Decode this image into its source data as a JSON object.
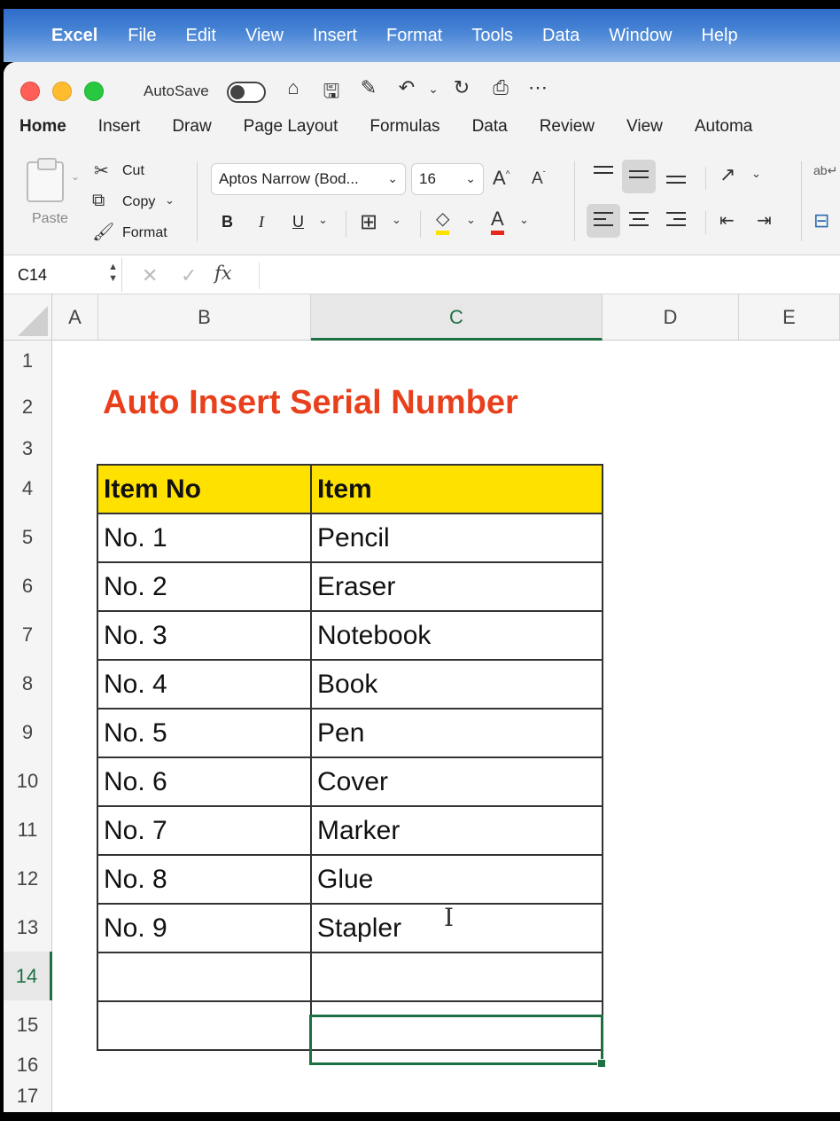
{
  "menubar": {
    "app": "Excel",
    "items": [
      "File",
      "Edit",
      "View",
      "Insert",
      "Format",
      "Tools",
      "Data",
      "Window",
      "Help"
    ]
  },
  "titlebar": {
    "autosave_label": "AutoSave"
  },
  "tabs": [
    "Home",
    "Insert",
    "Draw",
    "Page Layout",
    "Formulas",
    "Data",
    "Review",
    "View",
    "Automa"
  ],
  "ribbon": {
    "paste": "Paste",
    "cut": "Cut",
    "copy": "Copy",
    "format": "Format",
    "font_name": "Aptos Narrow (Bod...",
    "font_size": "16",
    "bold": "B",
    "italic": "I",
    "underline": "U"
  },
  "formula_bar": {
    "name_box": "C14",
    "fx": "fx",
    "formula": ""
  },
  "grid": {
    "columns": [
      "A",
      "B",
      "C",
      "D",
      "E"
    ],
    "selected_column": "C",
    "rows": [
      "1",
      "2",
      "3",
      "4",
      "5",
      "6",
      "7",
      "8",
      "9",
      "10",
      "11",
      "12",
      "13",
      "14",
      "15",
      "16",
      "17"
    ],
    "selected_row": "14",
    "title": "Auto Insert Serial Number",
    "table": {
      "headers": [
        "Item No",
        "Item"
      ],
      "rows": [
        [
          "No. 1",
          "Pencil"
        ],
        [
          "No. 2",
          "Eraser"
        ],
        [
          "No. 3",
          "Notebook"
        ],
        [
          "No. 4",
          "Book"
        ],
        [
          "No. 5",
          "Pen"
        ],
        [
          "No. 6",
          "Cover"
        ],
        [
          "No. 7",
          "Marker"
        ],
        [
          "No. 8",
          "Glue"
        ],
        [
          "No. 9",
          "Stapler"
        ],
        [
          "",
          ""
        ],
        [
          "",
          ""
        ]
      ]
    }
  },
  "colors": {
    "title": "#e8401c",
    "header_fill": "#ffe100",
    "selection": "#1d7044"
  }
}
